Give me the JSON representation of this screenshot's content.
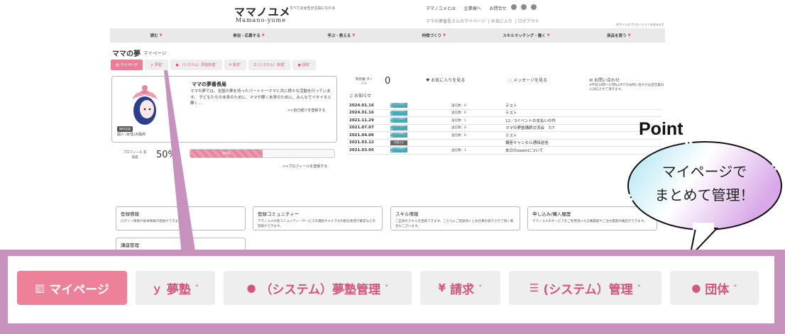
{
  "header": {
    "logo_ja": "ママノユメ",
    "logo_en": "Mamano-yume",
    "tagline": "すべての女性が主役になれる",
    "top_links": [
      "ママノユメとは",
      "企業様へ",
      "お問合せ"
    ],
    "user_links": [
      "ママの夢番長さんのマイページ",
      "お気に入り",
      "ログアウト"
    ],
    "promo_note": "本サイトはプロモーションを含みます"
  },
  "nav": {
    "items": [
      "読む",
      "参加・応募する",
      "学ぶ・教える",
      "仲間づくり",
      "スキルマッチング・働く",
      "商品を買う"
    ]
  },
  "page": {
    "title": "ママの夢",
    "subtitle": "マイページ"
  },
  "tabs": [
    {
      "label": "マイページ",
      "icon": "chart-icon"
    },
    {
      "label": "夢塾",
      "icon": "trophy-icon"
    },
    {
      "label": "（システム）夢塾管理",
      "icon": "users-icon"
    },
    {
      "label": "請求",
      "icon": "yen-icon"
    },
    {
      "label": "(システム）管理",
      "icon": "list-icon"
    },
    {
      "label": "団体",
      "icon": "users-icon"
    }
  ],
  "profile": {
    "name": "ママの夢番長局",
    "description": "ママの夢では、全国の夢を持ったパートナーママと共に様々な活動を行っています。 子どもたちの未来のために、ママが輝く未来のために、みんなでイキイキと輝く…",
    "intro_link": ">>自己紹介を登録する",
    "badge": "無料会員",
    "meta": "個人 /女性/大阪府",
    "completion_label": "プロフィール 充実度",
    "completion_value": "50%",
    "completion_bar_text": "50%",
    "completion_fraction": 0.5,
    "register_link": ">>プロフィールを登録する"
  },
  "info": {
    "points_label": "所有権 ポイント",
    "points_value": "0",
    "favorites": "お気に入りを見る",
    "messages": "メッセージを見る",
    "contact_title": "お問い合わせ",
    "contact_note": "※平日10時〜17時以外でのお問い合わせは翌営業日に対応させて頂きます。",
    "notice_title": "お知らせ"
  },
  "news": [
    {
      "date": "2024.01.16",
      "badge": "新しいお知らせ",
      "count": "送信数：0",
      "title": "テスト"
    },
    {
      "date": "2024.01.16",
      "badge": "新しいお知らせ",
      "count": "送信数：0",
      "title": "テスト"
    },
    {
      "date": "2021.11.29",
      "badge": "新しいお知らせ",
      "count": "送信数：1",
      "title": "12／3イベントお支払いの件"
    },
    {
      "date": "2021.07.07",
      "badge": "新しいお知らせ",
      "count": "送信数：0",
      "title": "ママの夢塾講師交流会　7/7"
    },
    {
      "date": "2021.04.06",
      "badge": "新しいお知らせ",
      "count": "送信数：0",
      "title": "テスト"
    },
    {
      "date": "2021.03.12",
      "badge": "お知らせ",
      "count": "",
      "title": "講座キャンセル通知送信"
    },
    {
      "date": "2021.03.05",
      "badge": "新しいお知らせ",
      "count": "送信数：1",
      "title": "本日のzoomについて"
    }
  ],
  "boxes": [
    {
      "title": "登録情報",
      "desc": "ログイン情報や基本情報の登録ができます。"
    },
    {
      "title": "登録コミュニティー",
      "desc": "ママノユメの各コミュニティーサービスの選択やメルマガの配信希望が確認などの登録ができます。"
    },
    {
      "title": "スキル情報",
      "desc": "ご自身のスキルを登録できます。こちらにご登録頂くとお仕事を紹介させて頂く場合もございます。"
    },
    {
      "title": "申し込み/購入履歴",
      "desc": "ママノユメのサービスをご利用頂いた応募履歴やご注文履歴の確認ができます。"
    },
    {
      "title": "講座管理",
      "desc": ""
    }
  ],
  "callout": {
    "point": "Point",
    "line1": "マイページで",
    "line2": "まとめて管理！"
  },
  "colors": {
    "accent": "#ec8199",
    "tab_text": "#d4567f",
    "frame": "#c792be",
    "badge": "#4aa8b8"
  }
}
